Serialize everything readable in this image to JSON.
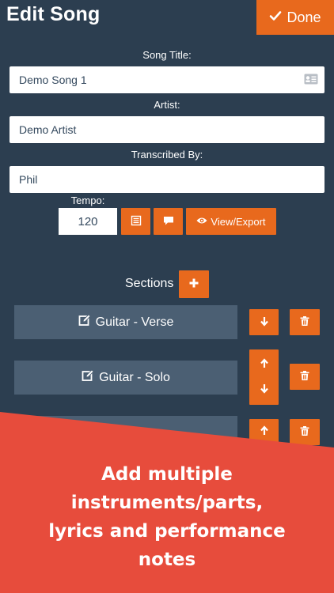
{
  "header": {
    "title": "Edit Song",
    "done_label": "Done"
  },
  "form": {
    "song_title_label": "Song Title:",
    "song_title_value": "Demo Song 1",
    "artist_label": "Artist:",
    "artist_value": "Demo Artist",
    "transcribed_label": "Transcribed By:",
    "transcribed_value": "Phil",
    "tempo_label": "Tempo:",
    "tempo_value": "120",
    "view_export_label": "View/Export"
  },
  "sections": {
    "label": "Sections",
    "items": [
      {
        "label": "Guitar - Verse"
      },
      {
        "label": "Guitar - Solo"
      },
      {
        "label": ""
      }
    ]
  },
  "promo": {
    "text": "Add multiple\ninstruments/parts,\nlyrics and performance\nnotes"
  },
  "colors": {
    "background": "#2c3e50",
    "accent": "#e8691d",
    "section_item": "#4b5f73",
    "banner": "#e74c3c"
  },
  "icons": [
    "check-icon",
    "contact-card-icon",
    "list-icon",
    "comment-icon",
    "eye-icon",
    "plus-icon",
    "edit-icon",
    "arrow-down-icon",
    "arrow-up-icon",
    "trash-icon"
  ]
}
